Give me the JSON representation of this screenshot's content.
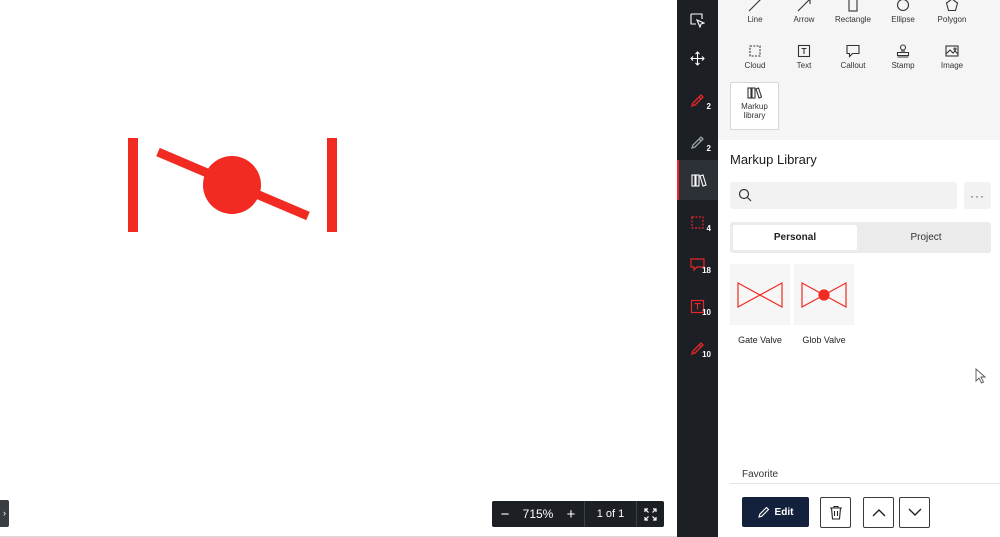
{
  "canvas": {
    "zoom_level": "715%",
    "page_count": "1 of 1",
    "accent_color": "#e8262b"
  },
  "tools": [
    {
      "label": "Line",
      "icon": "line-icon"
    },
    {
      "label": "Arrow",
      "icon": "arrow-icon"
    },
    {
      "label": "Rectangle",
      "icon": "rectangle-icon"
    },
    {
      "label": "Ellipse",
      "icon": "ellipse-icon"
    },
    {
      "label": "Polygon",
      "icon": "polygon-icon"
    },
    {
      "label": "Cloud",
      "icon": "cloud-icon"
    },
    {
      "label": "Text",
      "icon": "text-icon"
    },
    {
      "label": "Callout",
      "icon": "callout-icon"
    },
    {
      "label": "Stamp",
      "icon": "stamp-icon"
    },
    {
      "label": "Image",
      "icon": "image-icon"
    },
    {
      "label": "Markup library",
      "icon": "library-icon"
    }
  ],
  "rail": [
    {
      "icon": "select-icon",
      "count": ""
    },
    {
      "icon": "pan-icon",
      "count": ""
    },
    {
      "icon": "pen-red-icon",
      "count": "2"
    },
    {
      "icon": "pen-grey-icon",
      "count": "2"
    },
    {
      "icon": "library-icon",
      "count": ""
    },
    {
      "icon": "cloud-markup-icon",
      "count": "4"
    },
    {
      "icon": "callout-markup-icon",
      "count": "18"
    },
    {
      "icon": "text-markup-icon",
      "count": "10"
    },
    {
      "icon": "pen-markup-icon",
      "count": "10"
    }
  ],
  "library": {
    "title": "Markup Library",
    "search_placeholder": "",
    "more_label": "···",
    "tabs": [
      "Personal",
      "Project"
    ],
    "active_tab": "Personal",
    "items": [
      {
        "label": "Gate Valve",
        "icon": "gate-valve-icon"
      },
      {
        "label": "Glob Valve",
        "icon": "globe-valve-icon"
      }
    ],
    "favorite_label": "Favorite",
    "edit_label": "Edit"
  }
}
